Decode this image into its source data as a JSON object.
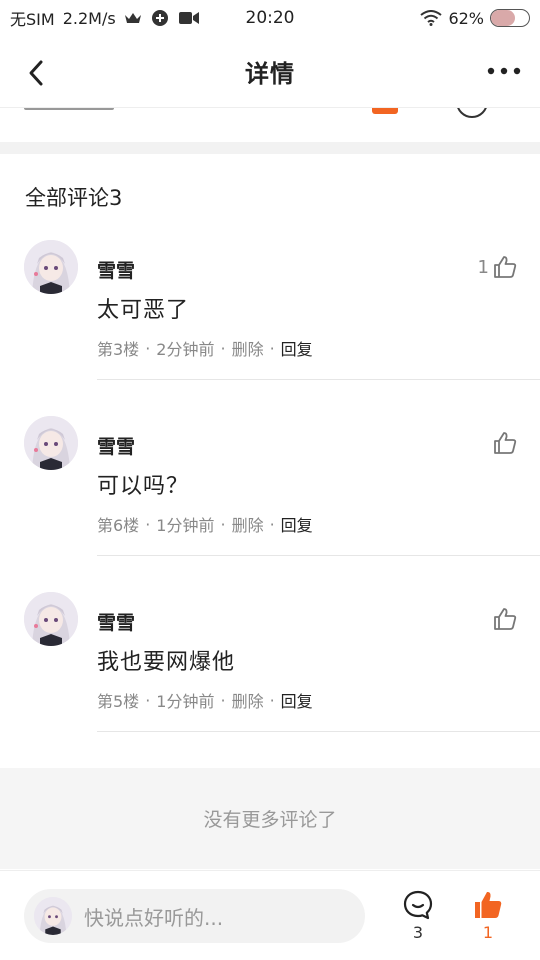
{
  "status_bar": {
    "carrier": "无SIM",
    "speed": "2.2M/s",
    "time": "20:20",
    "battery": "62%",
    "battery_level": 0.62
  },
  "nav": {
    "title": "详情"
  },
  "comments_section": {
    "header": "全部评论3",
    "items": [
      {
        "name": "雪雪",
        "text": "太可恶了",
        "floor": "第3楼",
        "time": "2分钟前",
        "delete": "删除",
        "reply": "回复",
        "likes": "1"
      },
      {
        "name": "雪雪",
        "text": "可以吗？",
        "floor": "第6楼",
        "time": "1分钟前",
        "delete": "删除",
        "reply": "回复",
        "likes": ""
      },
      {
        "name": "雪雪",
        "text": "我也要网爆他",
        "floor": "第5楼",
        "time": "1分钟前",
        "delete": "删除",
        "reply": "回复",
        "likes": ""
      }
    ],
    "no_more": "没有更多评论了",
    "meta_separator": "·"
  },
  "bottom_bar": {
    "input_placeholder": "快说点好听的...",
    "comment_count": "3",
    "like_count": "1"
  },
  "colors": {
    "accent": "#f26522",
    "text": "#222222",
    "muted": "#888888",
    "background_band": "#f5f5f5"
  }
}
